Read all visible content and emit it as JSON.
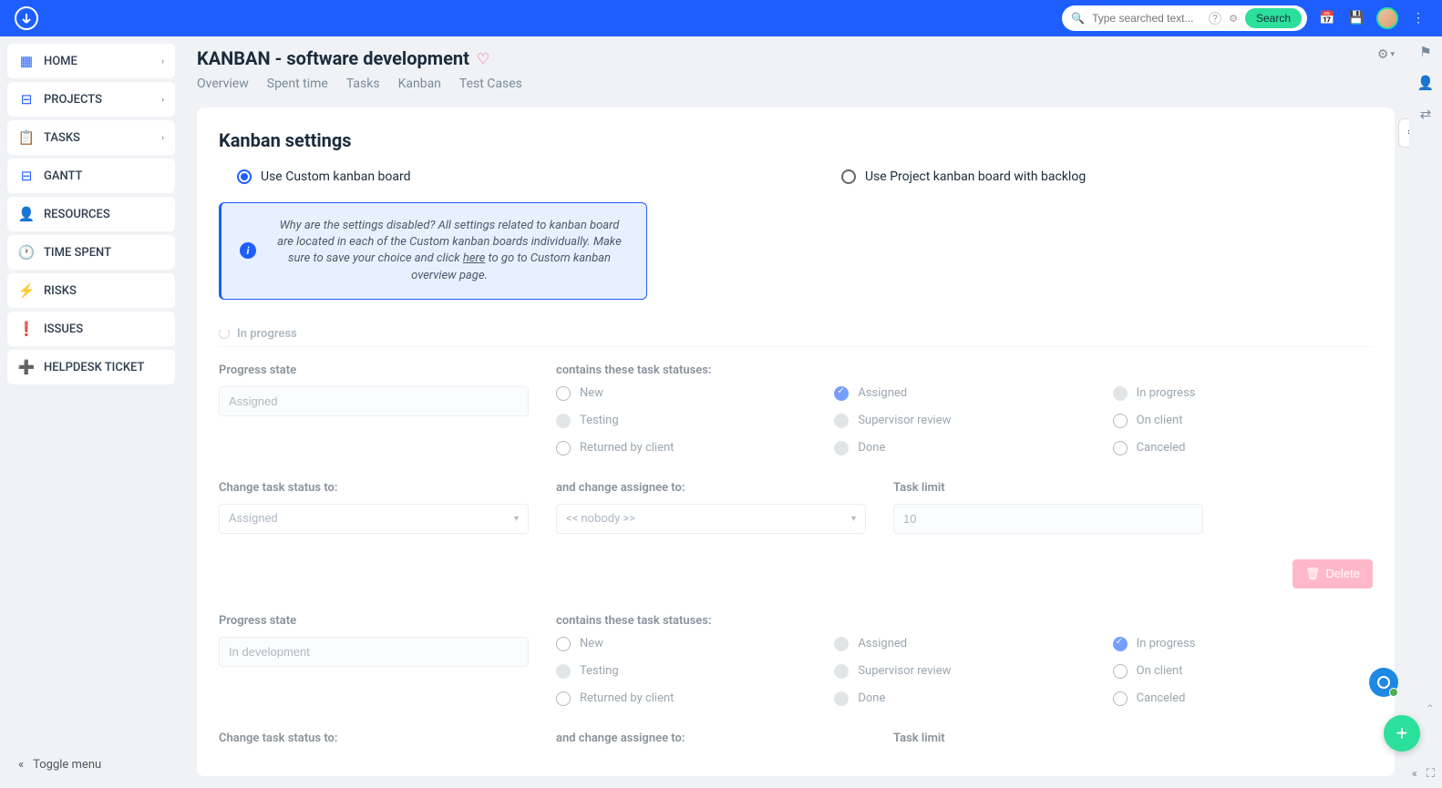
{
  "header": {
    "search_placeholder": "Type searched text...",
    "search_button": "Search"
  },
  "sidebar": {
    "items": [
      {
        "label": "HOME",
        "icon": "grid",
        "chevron": true
      },
      {
        "label": "PROJECTS",
        "icon": "tree",
        "chevron": true
      },
      {
        "label": "TASKS",
        "icon": "clipboard",
        "chevron": true
      },
      {
        "label": "GANTT",
        "icon": "tree",
        "chevron": false
      },
      {
        "label": "RESOURCES",
        "icon": "person",
        "chevron": false
      },
      {
        "label": "TIME SPENT",
        "icon": "clock",
        "chevron": false
      },
      {
        "label": "RISKS",
        "icon": "bolt",
        "chevron": false
      },
      {
        "label": "ISSUES",
        "icon": "alert",
        "chevron": false
      },
      {
        "label": "HELPDESK TICKET",
        "icon": "plus-box",
        "chevron": false
      }
    ],
    "toggle_label": "Toggle menu"
  },
  "page": {
    "title": "KANBAN - software development",
    "tabs": [
      "Overview",
      "Spent time",
      "Tasks",
      "Kanban",
      "Test Cases"
    ],
    "section_title": "Kanban settings",
    "radio_custom": "Use Custom kanban board",
    "radio_backlog": "Use Project kanban board with backlog",
    "info_text_1": "Why are the settings disabled? All settings related to kanban board are located in each of the Custom kanban boards individually. Make sure to save your choice and click ",
    "info_link": "here",
    "info_text_2": " to go to Custom kanban overview page.",
    "phase_label": "In progress",
    "labels": {
      "progress_state": "Progress state",
      "contains_statuses": "contains these task statuses:",
      "change_status": "Change task status to:",
      "change_assignee": "and change assignee to:",
      "task_limit": "Task limit"
    },
    "block1": {
      "progress_state": "Assigned",
      "change_status": "Assigned",
      "change_assignee": "<< nobody >>",
      "task_limit": "10"
    },
    "block2": {
      "progress_state": "In development"
    },
    "statuses": {
      "new": "New",
      "assigned": "Assigned",
      "in_progress": "In progress",
      "testing": "Testing",
      "supervisor": "Supervisor review",
      "on_client": "On client",
      "returned": "Returned by client",
      "done": "Done",
      "canceled": "Canceled"
    },
    "delete_label": "Delete"
  }
}
